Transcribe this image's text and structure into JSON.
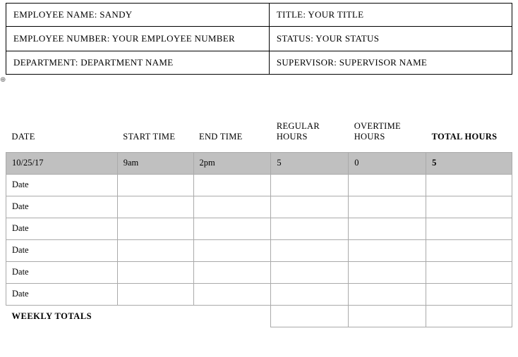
{
  "info": {
    "employee_name": "EMPLOYEE NAME: SANDY",
    "title": "TITLE: YOUR TITLE",
    "employee_number": "EMPLOYEE NUMBER: YOUR EMPLOYEE NUMBER",
    "status": "STATUS: YOUR STATUS",
    "department": "DEPARTMENT: DEPARTMENT NAME",
    "supervisor": "SUPERVISOR: SUPERVISOR NAME"
  },
  "headers": {
    "date": "DATE",
    "start_time": "START TIME",
    "end_time": "END TIME",
    "regular_hours": "REGULAR HOURS",
    "overtime_hours": "OVERTIME HOURS",
    "total_hours": "TOTAL HOURS"
  },
  "rows": [
    {
      "date": "10/25/17",
      "start": "9am",
      "end": "2pm",
      "regular": "5",
      "overtime": "0",
      "total": "5",
      "highlight": true
    },
    {
      "date": "Date",
      "start": "",
      "end": "",
      "regular": "",
      "overtime": "",
      "total": "",
      "highlight": false
    },
    {
      "date": "Date",
      "start": "",
      "end": "",
      "regular": "",
      "overtime": "",
      "total": "",
      "highlight": false
    },
    {
      "date": "Date",
      "start": "",
      "end": "",
      "regular": "",
      "overtime": "",
      "total": "",
      "highlight": false
    },
    {
      "date": "Date",
      "start": "",
      "end": "",
      "regular": "",
      "overtime": "",
      "total": "",
      "highlight": false
    },
    {
      "date": "Date",
      "start": "",
      "end": "",
      "regular": "",
      "overtime": "",
      "total": "",
      "highlight": false
    },
    {
      "date": "Date",
      "start": "",
      "end": "",
      "regular": "",
      "overtime": "",
      "total": "",
      "highlight": false
    }
  ],
  "footer": {
    "label": "WEEKLY TOTALS",
    "regular": "",
    "overtime": "",
    "total": ""
  },
  "anchor": "⊕"
}
